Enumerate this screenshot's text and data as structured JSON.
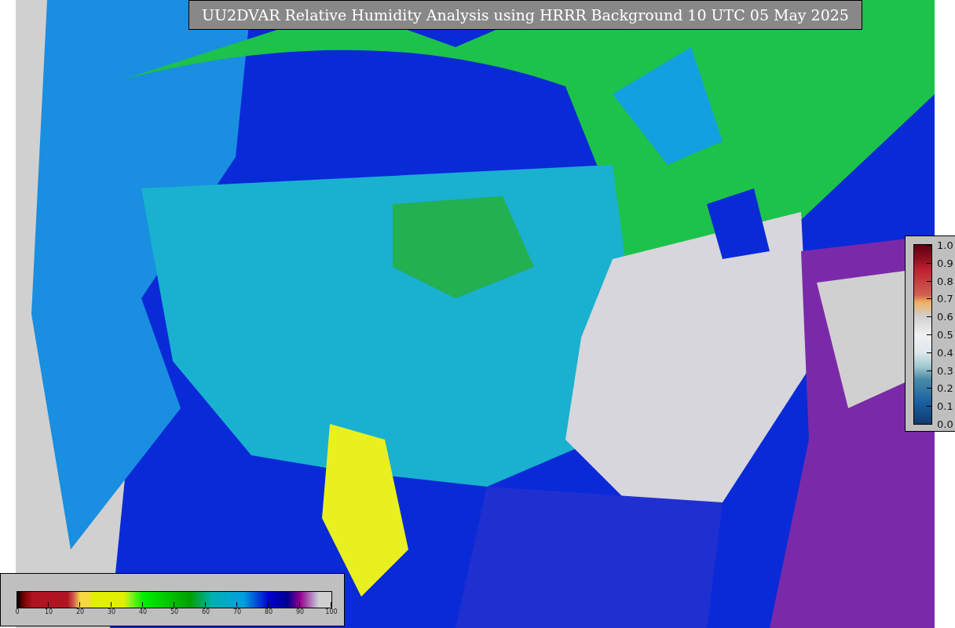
{
  "title": "UU2DVAR Relative Humidity Analysis using HRRR Background 10 UTC 05 May 2025",
  "humidity_colorbar": {
    "ticks": [
      "0",
      "10",
      "20",
      "30",
      "40",
      "50",
      "60",
      "70",
      "80",
      "90",
      "100"
    ]
  },
  "side_colorbar": {
    "ticks": [
      "1.0",
      "0.9",
      "0.8",
      "0.7",
      "0.6",
      "0.5",
      "0.4",
      "0.3",
      "0.2",
      "0.1",
      "0.0"
    ]
  }
}
